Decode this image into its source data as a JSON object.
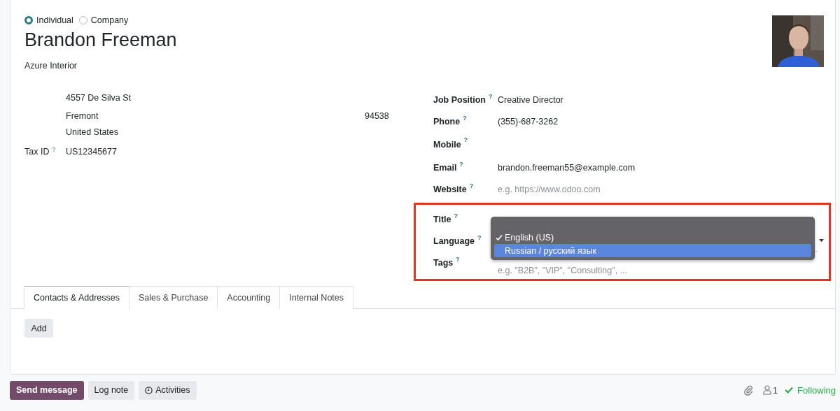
{
  "contact_type": [
    {
      "label": "Individual",
      "selected": true
    },
    {
      "label": "Company",
      "selected": false
    }
  ],
  "name": "Brandon Freeman",
  "company": "Azure Interior",
  "address": {
    "street": "4557 De Silva St",
    "city": "Fremont",
    "zip": "94538",
    "country": "United States"
  },
  "tax_id": {
    "label": "Tax ID",
    "help": "?",
    "value": "US12345677"
  },
  "fields": [
    {
      "label": "Job Position",
      "help": "?",
      "value": "Creative Director"
    },
    {
      "label": "Phone",
      "help": "?",
      "value": "(355)-687-3262"
    },
    {
      "label": "Mobile",
      "help": "?"
    },
    {
      "label": "Email",
      "help": "?",
      "value": "brandon.freeman55@example.com"
    },
    {
      "label": "Website",
      "help": "?",
      "placeholder": "e.g. https://www.odoo.com"
    }
  ],
  "highlighted_fields": [
    {
      "label": "Title",
      "help": "?",
      "kind": "text"
    },
    {
      "label": "Language",
      "help": "?",
      "kind": "select"
    },
    {
      "label": "Tags",
      "help": "?",
      "kind": "text",
      "placeholder": "e.g. \"B2B\", \"VIP\", \"Consulting\", ..."
    }
  ],
  "language_menu": [
    {
      "label": "English (US)",
      "checked": true,
      "selected": false
    },
    {
      "label": "Russian / русский язык",
      "checked": false,
      "selected": true
    }
  ],
  "tabs": [
    {
      "label": "Contacts & Addresses",
      "selected": true
    },
    {
      "label": "Sales & Purchase",
      "selected": false
    },
    {
      "label": "Accounting",
      "selected": false
    },
    {
      "label": "Internal Notes",
      "selected": false
    }
  ],
  "add_button": "Add",
  "chatter_buttons": [
    {
      "label": "Send message",
      "kind": "primary"
    },
    {
      "label": "Log note",
      "kind": "secondary"
    },
    {
      "label": "Activities",
      "kind": "activities"
    }
  ],
  "followers": "1",
  "following": "Following"
}
